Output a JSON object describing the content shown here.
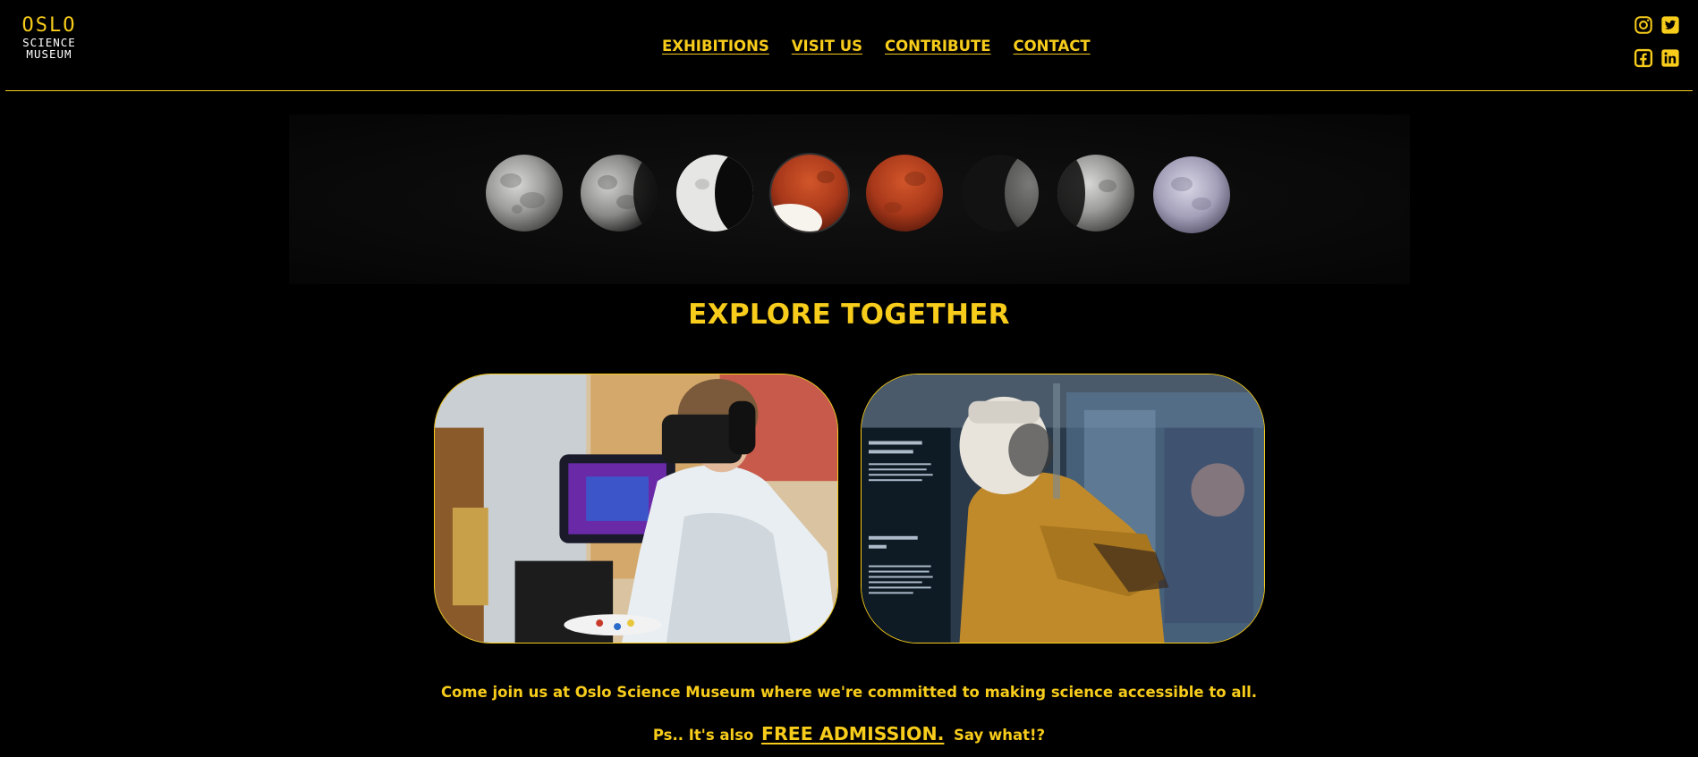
{
  "brand": {
    "name_line1": "OSLO",
    "name_line2": "SCIENCE",
    "name_line3": "MUSEUM"
  },
  "nav": {
    "items": [
      {
        "label": "EXHIBITIONS"
      },
      {
        "label": "VISIT US"
      },
      {
        "label": "CONTRIBUTE"
      },
      {
        "label": "CONTACT"
      }
    ]
  },
  "social": {
    "icons": [
      "instagram-icon",
      "twitter-icon",
      "facebook-icon",
      "linkedin-icon"
    ]
  },
  "hero": {
    "image": "lunar-eclipse-phases"
  },
  "section": {
    "heading": "EXPLORE TOGETHER"
  },
  "cards": [
    {
      "image": "vr-headset-painting"
    },
    {
      "image": "astronaut-suit-exhibit"
    }
  ],
  "footer": {
    "tagline": "Come join us at Oslo Science Museum where we're committed to making science accessible to all.",
    "admission_prefix": "Ps.. It's also",
    "admission_link": "FREE ADMISSION.",
    "admission_suffix": "Say what!?"
  },
  "colors": {
    "accent": "#f7cc1b",
    "background": "#000000"
  }
}
